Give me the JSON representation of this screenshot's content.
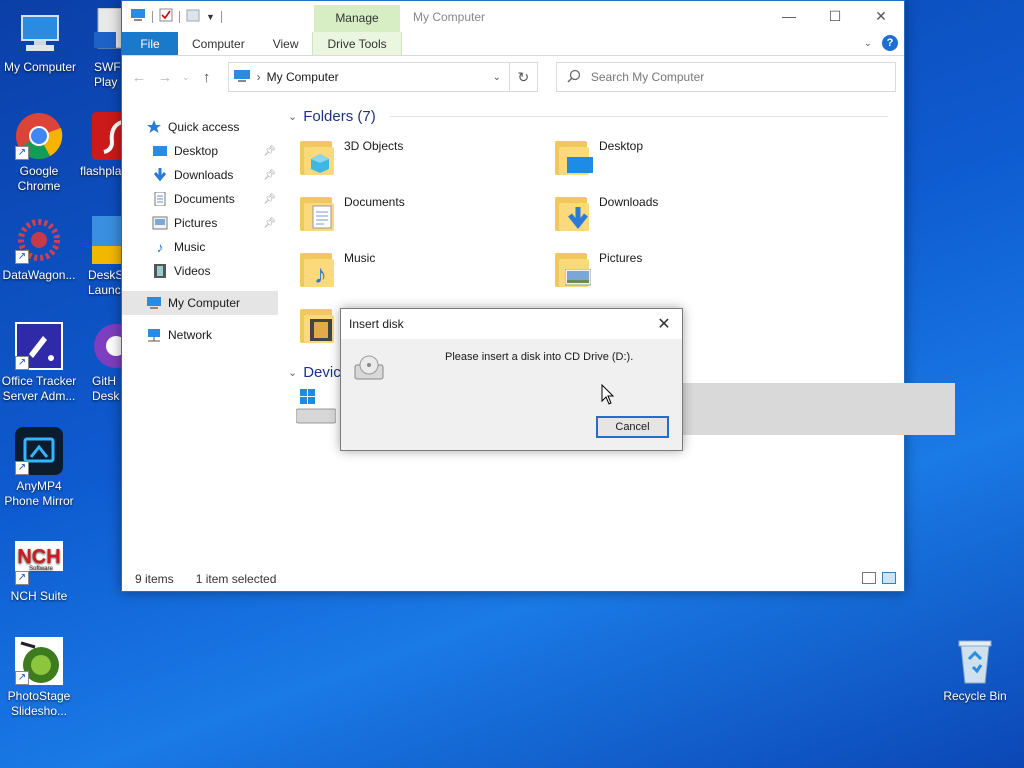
{
  "desktop": {
    "icons_left": [
      {
        "name": "my-computer",
        "label": "My Computer"
      },
      {
        "name": "google-chrome",
        "label": "Google Chrome"
      },
      {
        "name": "datawagon",
        "label": "DataWagon..."
      },
      {
        "name": "office-tracker",
        "label": "Office Tracker Server Adm..."
      },
      {
        "name": "anymp4",
        "label": "AnyMP4 Phone Mirror"
      },
      {
        "name": "nch-suite",
        "label": "NCH Suite"
      },
      {
        "name": "photostage",
        "label": "PhotoStage Slidesho..."
      }
    ],
    "icons_partial": [
      {
        "name": "swf-player",
        "label": "SWF Play"
      },
      {
        "name": "flashplayer",
        "label": "flashpla"
      },
      {
        "name": "desksoft",
        "label": "DeskS Launc"
      },
      {
        "name": "github-desktop",
        "label": "GitH Desk"
      }
    ],
    "recycle_bin": "Recycle Bin",
    "nch_logo": "NCH",
    "nch_logo_sub": "Software"
  },
  "explorer": {
    "title": "My Computer",
    "manage_tab": "Manage",
    "tabs": [
      "File",
      "Computer",
      "View",
      "Drive Tools"
    ],
    "address": "My Computer",
    "search_placeholder": "Search My Computer",
    "nav": {
      "quick_access": "Quick access",
      "items": [
        "Desktop",
        "Downloads",
        "Documents",
        "Pictures",
        "Music",
        "Videos"
      ],
      "my_computer": "My Computer",
      "network": "Network"
    },
    "folders_header": "Folders (7)",
    "folders": [
      "3D Objects",
      "Desktop",
      "Documents",
      "Downloads",
      "Music",
      "Pictures"
    ],
    "devices_header": "Devic",
    "status": {
      "items": "9 items",
      "selected": "1 item selected"
    }
  },
  "dialog": {
    "title": "Insert disk",
    "message": "Please insert a disk into CD Drive (D:).",
    "cancel": "Cancel"
  },
  "colors": {
    "accent": "#1979ca",
    "manage_green": "#d7eec5",
    "header_blue": "#1e3287"
  }
}
